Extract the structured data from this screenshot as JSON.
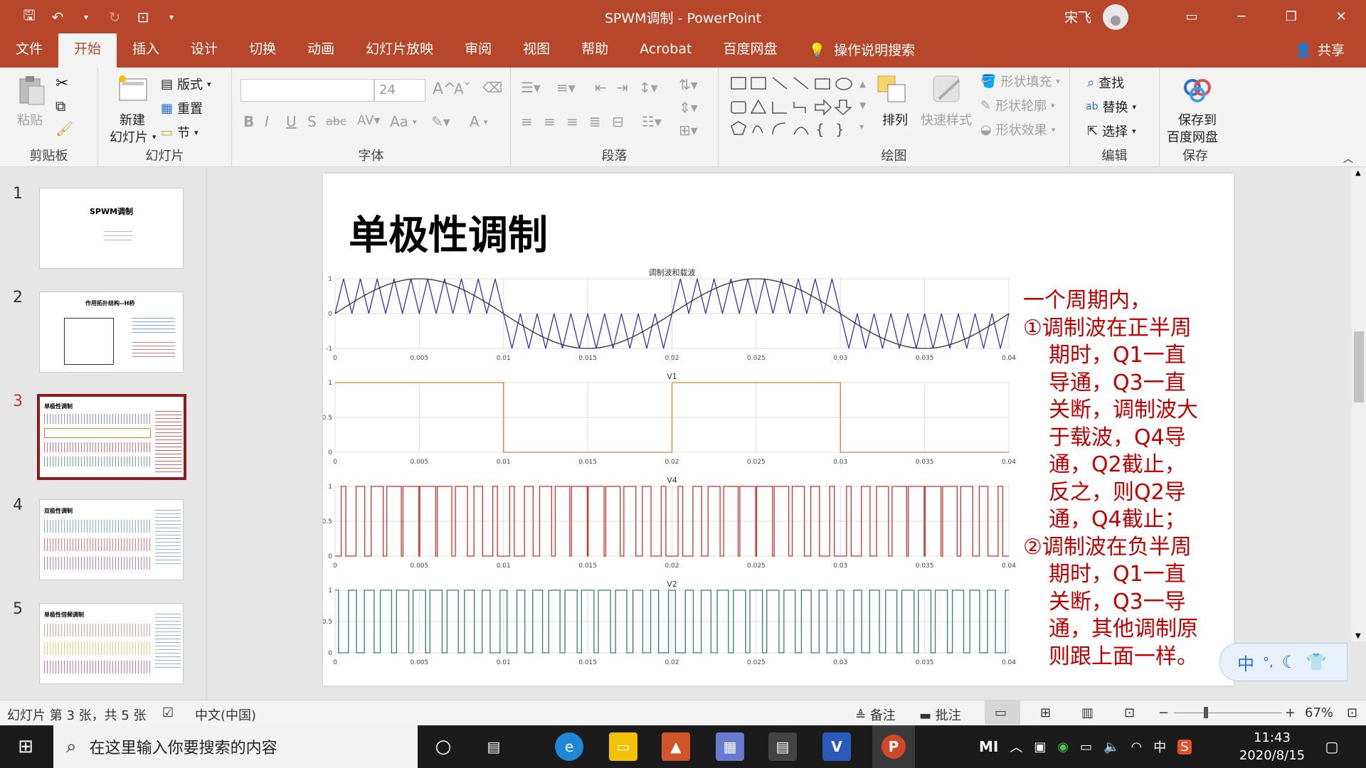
{
  "window": {
    "title": "SPWM调制 - PowerPoint",
    "user_name": "宋飞",
    "accent": "#b7472a"
  },
  "ribbon_tabs": [
    "文件",
    "开始",
    "插入",
    "设计",
    "切换",
    "动画",
    "幻灯片放映",
    "审阅",
    "视图",
    "帮助",
    "Acrobat",
    "百度网盘"
  ],
  "active_tab": "开始",
  "tell_me": "操作说明搜索",
  "share": "共享",
  "ribbon": {
    "clipboard": {
      "label": "剪贴板",
      "paste": "粘贴"
    },
    "slides": {
      "label": "幻灯片",
      "new_slide_line1": "新建",
      "new_slide_line2": "幻灯片",
      "layout": "版式",
      "reset": "重置",
      "section": "节"
    },
    "font": {
      "label": "字体",
      "font_size": "24",
      "bold": "B",
      "italic": "I",
      "underline": "U",
      "shadow": "S",
      "strike": "abc",
      "case": "Aa",
      "color": "A"
    },
    "paragraph": {
      "label": "段落"
    },
    "drawing": {
      "label": "绘图",
      "arrange": "排列",
      "quick_styles": "快速样式",
      "shape_fill": "形状填充",
      "shape_outline": "形状轮廓",
      "shape_effects": "形状效果"
    },
    "editing": {
      "label": "编辑",
      "find": "查找",
      "replace": "替换",
      "select": "选择"
    },
    "save": {
      "label": "保存",
      "button_line1": "保存到",
      "button_line2": "百度网盘"
    }
  },
  "thumbnails": [
    {
      "num": "1",
      "title": "SPWM调制"
    },
    {
      "num": "2",
      "title": "作用拓扑结构--H桥"
    },
    {
      "num": "3",
      "title": "单极性调制"
    },
    {
      "num": "4",
      "title": "双极性调制"
    },
    {
      "num": "5",
      "title": "单极性倍频调制"
    }
  ],
  "active_slide": "3",
  "slide": {
    "title": "单极性调制",
    "text_lines": [
      {
        "text": "一个周期内，",
        "indent": false
      },
      {
        "text": "①调制波在正半周",
        "indent": false
      },
      {
        "text": "期时，Q1一直",
        "indent": true
      },
      {
        "text": "导通，Q3一直",
        "indent": true
      },
      {
        "text": "关断，调制波大",
        "indent": true
      },
      {
        "text": "于载波，Q4导",
        "indent": true
      },
      {
        "text": "通，Q2截止，",
        "indent": true
      },
      {
        "text": "反之，则Q2导",
        "indent": true
      },
      {
        "text": "通，Q4截止；",
        "indent": true
      },
      {
        "text": "②调制波在负半周",
        "indent": false
      },
      {
        "text": "期时，Q1一直",
        "indent": true
      },
      {
        "text": "关断，Q3一导",
        "indent": true
      },
      {
        "text": "通，其他调制原",
        "indent": true
      },
      {
        "text": "则跟上面一样。",
        "indent": true
      }
    ]
  },
  "chart_data": [
    {
      "type": "line",
      "title": "调制波和载波",
      "xlim": [
        0,
        0.04
      ],
      "ylim": [
        -1,
        1
      ],
      "x_ticks": [
        "0",
        "0.005",
        "0.01",
        "0.015",
        "0.02",
        "0.025",
        "0.03",
        "0.035",
        "0.04"
      ],
      "y_ticks": [
        "1",
        "0",
        "-1"
      ],
      "series": [
        {
          "color": "#3333aa",
          "kind": "unipolar-triangle-carrier",
          "carrier_periods_per_half": 10
        },
        {
          "color": "#333333",
          "kind": "sine",
          "frequency_hz": 50,
          "amplitude": 1
        }
      ]
    },
    {
      "type": "line",
      "title": "V1",
      "xlim": [
        0,
        0.04
      ],
      "ylim": [
        0,
        1
      ],
      "x_ticks": [
        "0",
        "0.005",
        "0.01",
        "0.015",
        "0.02",
        "0.025",
        "0.03",
        "0.035",
        "0.04"
      ],
      "y_ticks": [
        "1",
        "0.5",
        "0"
      ],
      "series": [
        {
          "color": "#d9822b",
          "kind": "square",
          "x": [
            0,
            0.01,
            0.01,
            0.02,
            0.02,
            0.03,
            0.03,
            0.04
          ],
          "y": [
            1,
            1,
            0,
            0,
            1,
            1,
            0,
            0
          ]
        }
      ]
    },
    {
      "type": "line",
      "title": "V4",
      "xlim": [
        0,
        0.04
      ],
      "ylim": [
        0,
        1
      ],
      "x_ticks": [
        "0",
        "0.005",
        "0.01",
        "0.015",
        "0.02",
        "0.025",
        "0.03",
        "0.035",
        "0.04"
      ],
      "y_ticks": [
        "1",
        "0.5",
        "0"
      ],
      "series": [
        {
          "color": "#cc3333",
          "kind": "pwm",
          "pulses": 40
        }
      ]
    },
    {
      "type": "line",
      "title": "V2",
      "xlim": [
        0,
        0.04
      ],
      "ylim": [
        0,
        1
      ],
      "x_ticks": [
        "0",
        "0.005",
        "0.01",
        "0.015",
        "0.02",
        "0.025",
        "0.03",
        "0.035",
        "0.04"
      ],
      "y_ticks": [
        "1",
        "0.5",
        "0"
      ],
      "series": [
        {
          "color": "#3a7d6b",
          "kind": "pwm-inverse",
          "pulses": 40
        }
      ]
    }
  ],
  "status": {
    "slide_info": "幻灯片 第 3 张，共 5 张",
    "language": "中文(中国)",
    "notes": "备注",
    "comments": "批注",
    "zoom": "67%"
  },
  "taskbar": {
    "search_placeholder": "在这里输入你要搜索的内容",
    "ime_mode": "中",
    "time": "11:43",
    "date": "2020/8/15"
  }
}
